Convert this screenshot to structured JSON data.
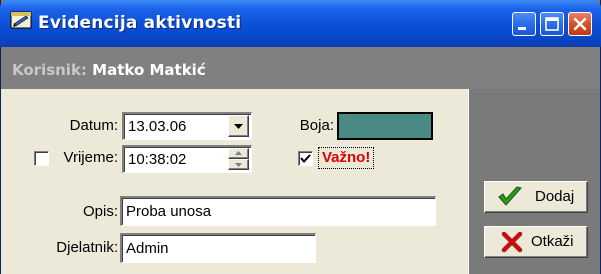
{
  "window": {
    "title": "Evidencija aktivnosti"
  },
  "user": {
    "label": "Korisnik:",
    "name": "Matko Matkić"
  },
  "form": {
    "datum_label": "Datum:",
    "datum_value": "13.03.06",
    "boja_label": "Boja:",
    "boja_color": "#4a8a84",
    "vrijeme_label": "Vrijeme:",
    "vrijeme_checked": false,
    "vrijeme_value": "10:38:02",
    "vazno_label": "Važno!",
    "vazno_checked": true,
    "opis_label": "Opis:",
    "opis_value": "Proba unosa",
    "djelatnik_label": "Djelatnik:",
    "djelatnik_value": "Admin"
  },
  "buttons": {
    "add_label": "Dodaj",
    "cancel_label": "Otkaži"
  },
  "colors": {
    "title_bar": "#0a4fd6",
    "header_strip": "#808080",
    "form_bg": "#ece9d8",
    "vazno_text": "#e00000",
    "add_icon": "#2e9a1a",
    "cancel_icon": "#c01010"
  }
}
